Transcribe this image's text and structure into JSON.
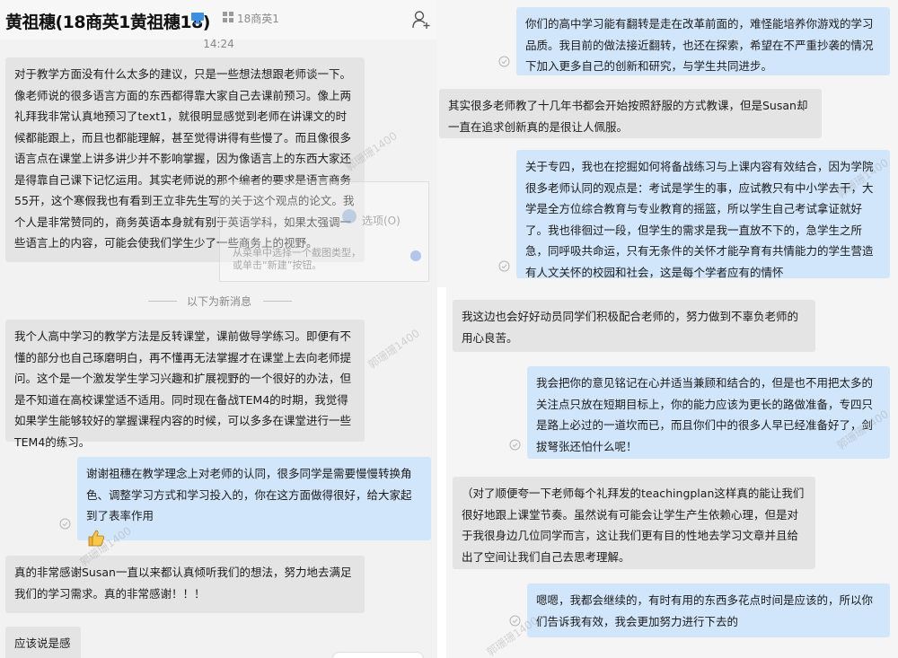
{
  "header": {
    "title": "黄祖穗(18商英1黄祖穗18)",
    "group_name": "18商英1"
  },
  "chat_left": {
    "timestamp": "14:24",
    "divider_label": "以下为新消息",
    "messages": [
      {
        "id": "m1",
        "side": "received",
        "text": "对于教学方面没有什么太多的建议，只是一些想法想跟老师谈一下。像老师说的很多语言方面的东西都得靠大家自己去课前预习。像上两礼拜我非常认真地预习了text1，就很明显感觉到老师在讲课文的时候都能跟上，而且也都能理解，甚至觉得讲得有些慢了。而且像很多语言点在课堂上讲多讲少并不影响掌握，因为像语言上的东西大家还是得靠自己课下记忆运用。其实老师说的那个编者的要求是语言商务55开，这个寒假我也有看到王立非先生写的关于这个观点的论文。我个人是非常赞同的，商务英语本身就有别于英语学科，如果太强调一些语言上的内容，可能会使我们学生少了一些商务上的视野。"
      },
      {
        "id": "m2",
        "side": "received",
        "text": "我个人高中学习的教学方法是反转课堂，课前做导学练习。即便有不懂的部分也自己琢磨明白，再不懂再无法掌握才在课堂上去向老师提问。这个是一个激发学生学习兴趣和扩展视野的一个很好的办法，但是不知道在高校课堂适不适用。同时现在备战TEM4的时期，我觉得如果学生能够较好的掌握课程内容的时候，可以多多在课堂进行一些TEM4的练习。"
      },
      {
        "id": "m3",
        "side": "sent",
        "text": "谢谢祖穗在教学理念上对老师的认同，很多同学是需要慢慢转换角色、调整学习方式和学习投入的，你在这方面做得很好，给大家起到了表率作用"
      },
      {
        "id": "m4",
        "side": "received",
        "text": "真的非常感谢Susan一直以来都认真倾听我们的想法，努力地去满足我们的学习需求。真的非常感谢！！！"
      },
      {
        "id": "m5",
        "side": "received",
        "text": "应该说是感动"
      }
    ],
    "overlay": {
      "option_label": "选项(O)",
      "tip": "从菜单中选择一个截图类型，或单击“新建”按钮。"
    }
  },
  "chat_right": {
    "messages": [
      {
        "id": "r1",
        "side": "sent",
        "text": "你们的高中学习能有翻转是走在改革前面的，难怪能培养你游戏的学习品质。我目前的做法接近翻转，也还在探索，希望在不严重抄袭的情况下加入更多自己的创新和研究，与学生共同进步。"
      },
      {
        "id": "r2",
        "side": "received",
        "text": "其实很多老师教了十几年书都会开始按照舒服的方式教课，但是Susan却一直在追求创新真的是很让人佩服。"
      },
      {
        "id": "r3",
        "side": "sent",
        "text": "关于专四，我也在挖掘如何将备战练习与上课内容有效结合，因为学院很多老师认同的观点是：考试是学生的事，应试教只有中小学去干，大学是全方位综合教育与专业教育的摇篮，所以学生自己考试拿证就好了。我也徘徊过一段，但学生的需求是我一直放不下的，急学生之所急，同呼吸共命运，只有无条件的关怀才能孕育有共情能力的学生营造有人文关怀的校园和社会，这是每个学者应有的情怀"
      },
      {
        "id": "r4",
        "side": "received",
        "text": "我这边也会好好动员同学们积极配合老师的，努力做到不辜负老师的用心良苦。"
      },
      {
        "id": "r5",
        "side": "sent",
        "text": "我会把你的意见铭记在心并适当兼顾和结合的，但是也不用把太多的关注点只放在短期目标上，你的能力应该为更长的路做准备，专四只是路上必过的一道坎而已，而且你们中的很多人早已经准备好了，剑拔弩张还怕什么呢！"
      },
      {
        "id": "r6",
        "side": "received",
        "text": "（对了顺便夸一下老师每个礼拜发的teachingplan这样真的能让我们很好地跟上课堂节奏。虽然说有可能会让学生产生依赖心理，但是对于我很身边几位同学而言，这让我们更有目的性地去学习文章并且给出了空间让我们自己去思考理解。"
      },
      {
        "id": "r7",
        "side": "sent",
        "text": "嗯嗯，我都会继续的，有时有用的东西多花点时间是应该的，所以你们告诉我有效，我会更加努力进行下去的"
      }
    ]
  },
  "watermark": "郭珊珊1400",
  "colors": {
    "sent_bubble": "#d2e6fb",
    "received_bubble": "#e4e4e4",
    "background": "#f2f2f2"
  },
  "icons": [
    "monitor-icon",
    "group-icon",
    "add-user-icon",
    "check-circle-icon",
    "thumbs-up-icon"
  ]
}
